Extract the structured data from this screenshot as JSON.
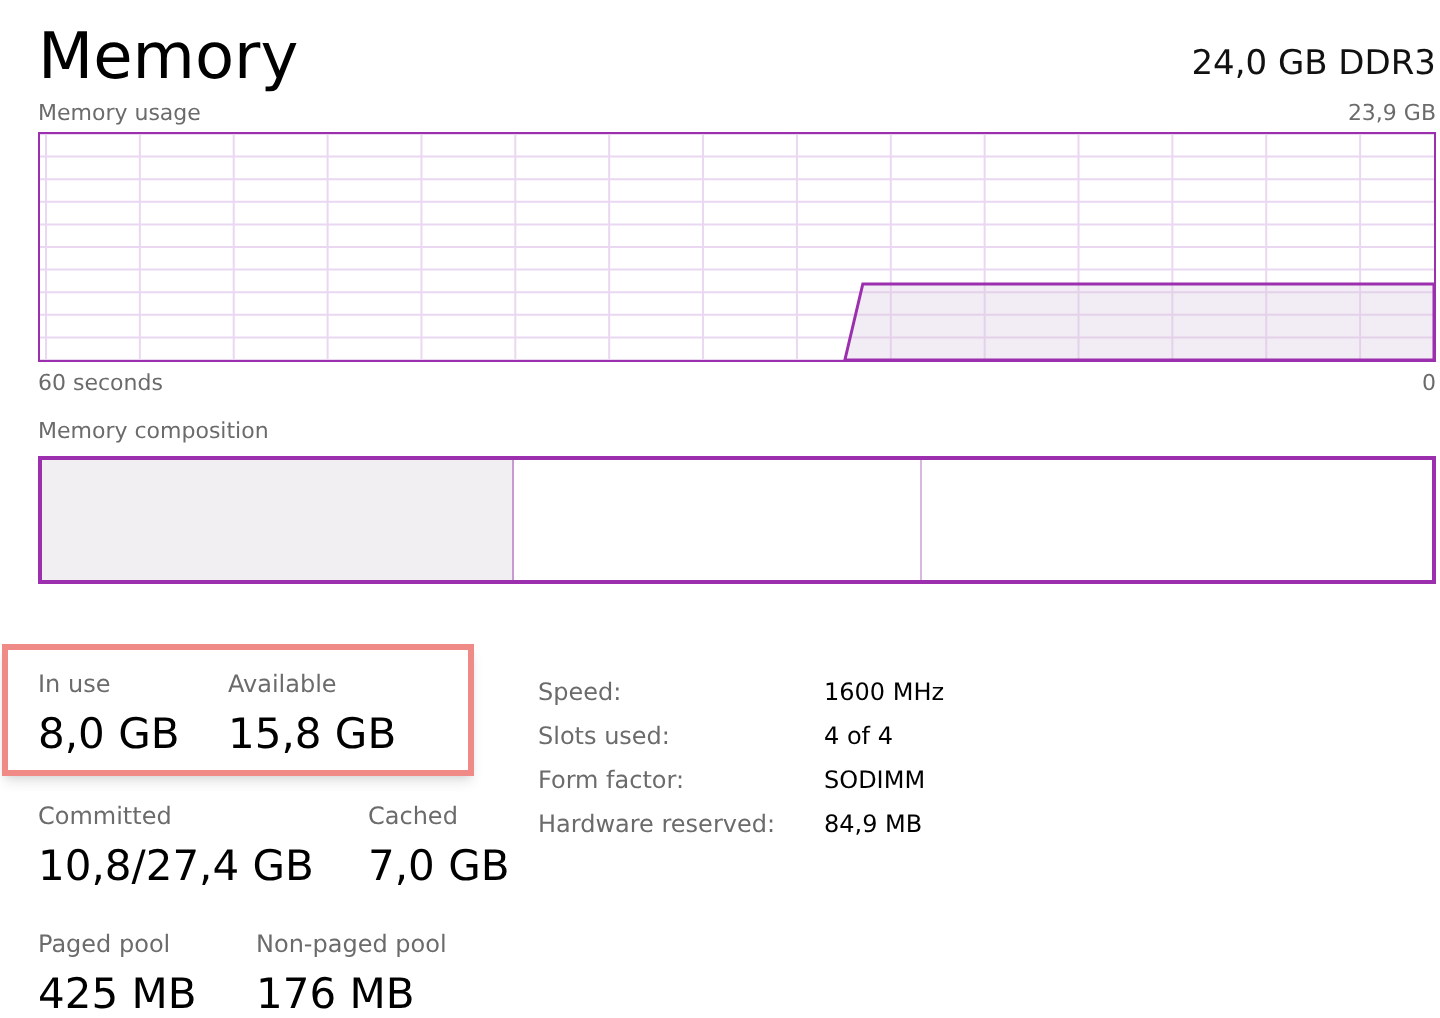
{
  "title": "Memory",
  "capacity": "24,0 GB DDR3",
  "usage_graph": {
    "label": "Memory usage",
    "max_label": "23,9 GB",
    "start_label": "60 seconds",
    "end_label": "0"
  },
  "composition": {
    "label": "Memory composition"
  },
  "stat_rows": [
    {
      "highlighted": true,
      "stats": [
        {
          "label": "In use",
          "value": "8,0 GB"
        },
        {
          "label": "Available",
          "value": "15,8 GB"
        }
      ]
    },
    {
      "highlighted": false,
      "stats": [
        {
          "label": "Committed",
          "value": "10,8/27,4 GB"
        },
        {
          "label": "Cached",
          "value": "7,0 GB"
        }
      ]
    },
    {
      "highlighted": false,
      "stats": [
        {
          "label": "Paged pool",
          "value": "425 MB"
        },
        {
          "label": "Non-paged pool",
          "value": "176 MB"
        }
      ]
    }
  ],
  "details": [
    {
      "label": "Speed:",
      "value": "1600 MHz"
    },
    {
      "label": "Slots used:",
      "value": "4 of 4"
    },
    {
      "label": "Form factor:",
      "value": "SODIMM"
    },
    {
      "label": "Hardware reserved:",
      "value": "84,9 MB"
    }
  ]
}
